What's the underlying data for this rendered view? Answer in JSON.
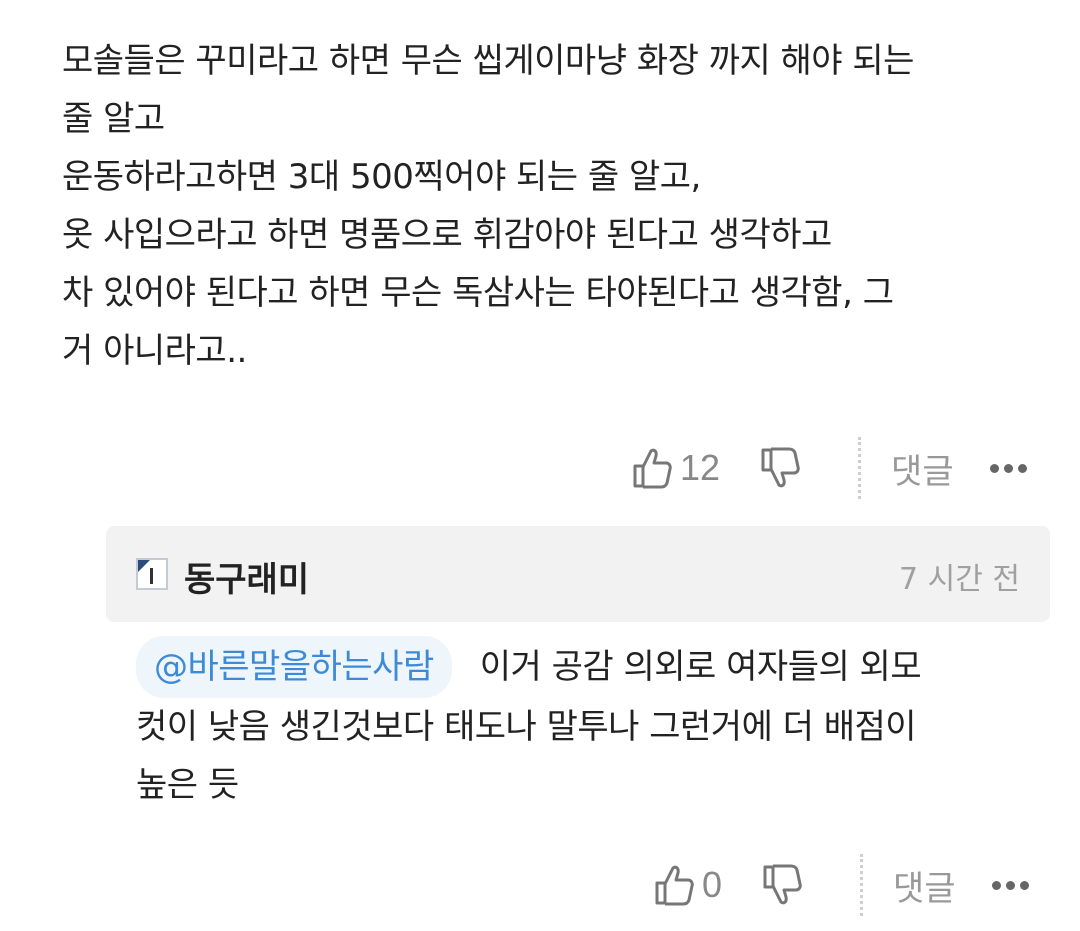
{
  "comment": {
    "lines": [
      "모솔들은 꾸미라고 하면 무슨 씹게이마냥 화장 까지 해야 되는",
      "줄 알고",
      "운동하라고하면 3대 500찍어야 되는 줄 알고,",
      "옷 사입으라고 하면 명품으로 휘감아야 된다고 생각하고",
      "차 있어야 된다고 하면 무슨 독삼사는 타야된다고 생각함, 그",
      "거 아니라고.."
    ],
    "actions": {
      "like_count": "12",
      "reply_label": "댓글",
      "like_icon": "thumbs-up-icon",
      "dislike_icon": "thumbs-down-icon",
      "more_icon": "more-dots-icon"
    }
  },
  "reply": {
    "username": "동구래미",
    "time": "7 시간 전",
    "mention": "@바른말을하는사람",
    "lines": [
      "이거 공감 의외로 여자들의 외모",
      "컷이 낮음 생긴것보다 태도나 말투나 그런거에 더 배점이",
      "높은 듯"
    ],
    "actions": {
      "like_count": "0",
      "reply_label": "댓글"
    }
  },
  "colors": {
    "text": "#222222",
    "muted": "#999999",
    "mention_text": "#3d8bd6",
    "mention_bg": "#eef5fb",
    "reply_header_bg": "#f2f2f2"
  }
}
